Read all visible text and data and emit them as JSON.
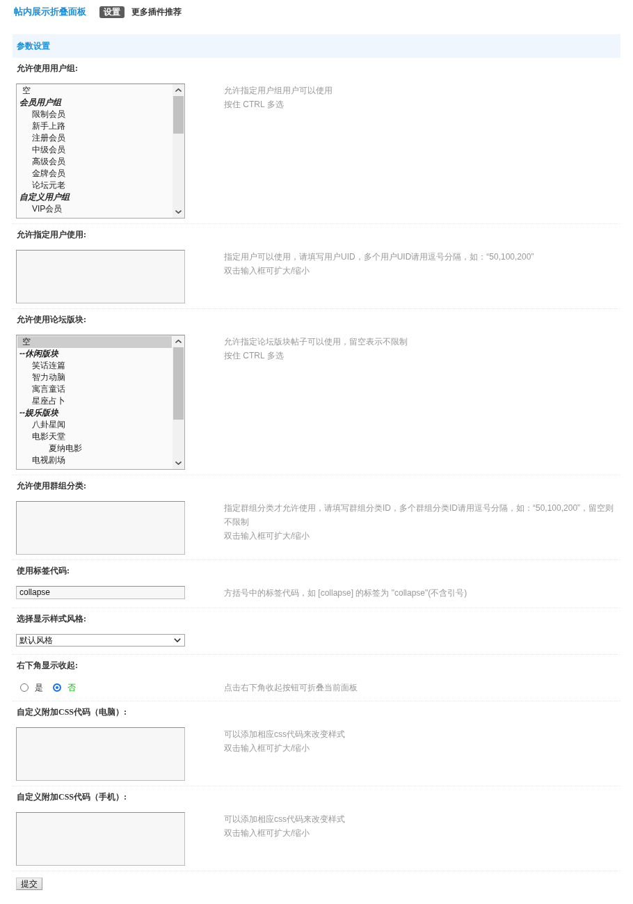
{
  "header": {
    "title": "帖内展示折叠面板",
    "tabs": [
      {
        "label": "设置",
        "selected": true
      },
      {
        "label": "更多插件推荐",
        "selected": false
      }
    ]
  },
  "section": {
    "title": "参数设置"
  },
  "settings": [
    {
      "kind": "listbox",
      "label": "允许使用用户组:",
      "items": [
        {
          "kind": "option",
          "label": "空",
          "selected": false
        },
        {
          "kind": "group",
          "label": "会员用户组",
          "children": [
            {
              "kind": "option",
              "label": "限制会员",
              "selected": false
            },
            {
              "kind": "option",
              "label": "新手上路",
              "selected": false
            },
            {
              "kind": "option",
              "label": "注册会员",
              "selected": false
            },
            {
              "kind": "option",
              "label": "中级会员",
              "selected": false
            },
            {
              "kind": "option",
              "label": "高级会员",
              "selected": false
            },
            {
              "kind": "option",
              "label": "金牌会员",
              "selected": false
            },
            {
              "kind": "option",
              "label": "论坛元老",
              "selected": false
            }
          ]
        },
        {
          "kind": "group",
          "label": "自定义用户组",
          "children": [
            {
              "kind": "option",
              "label": "VIP会员",
              "selected": false
            }
          ]
        }
      ],
      "tips": [
        "允许指定用户组用户可以使用",
        "按住 CTRL 多选"
      ]
    },
    {
      "kind": "textarea",
      "label": "允许指定用户使用:",
      "tips": [
        "指定用户可以使用，请填写用户UID，多个用户UID请用逗号分隔，如：“50,100,200”",
        "双击输入框可扩大/缩小"
      ]
    },
    {
      "kind": "listbox",
      "label": "允许使用论坛版块:",
      "items": [
        {
          "kind": "option",
          "label": "空",
          "selected": true
        },
        {
          "kind": "group",
          "label": "--休闲版块",
          "children": [
            {
              "kind": "option",
              "label": "笑话连篇",
              "selected": false
            },
            {
              "kind": "option",
              "label": "智力动脑",
              "selected": false
            },
            {
              "kind": "option",
              "label": "寓言童话",
              "selected": false
            },
            {
              "kind": "option",
              "label": "星座占卜",
              "selected": false
            }
          ]
        },
        {
          "kind": "group",
          "label": "--娱乐版块",
          "children": [
            {
              "kind": "option",
              "label": "八卦星闻",
              "selected": false
            },
            {
              "kind": "option",
              "label": "电影天堂",
              "selected": false,
              "children": [
                {
                  "kind": "option",
                  "label": "夏纳电影",
                  "selected": false
                }
              ]
            },
            {
              "kind": "option",
              "label": "电视剧场",
              "selected": false
            }
          ]
        }
      ],
      "tips": [
        "允许指定论坛版块帖子可以使用，留空表示不限制",
        "按住 CTRL 多选"
      ]
    },
    {
      "kind": "textarea",
      "label": "允许使用群组分类:",
      "tips": [
        "指定群组分类才允许使用，请填写群组分类ID，多个群组分类ID请用逗号分隔，如：“50,100,200”，留空则不限制",
        "双击输入框可扩大/缩小"
      ]
    },
    {
      "kind": "text",
      "label": "使用标签代码:",
      "value": "collapse",
      "tips": [
        "方括号中的标签代码，如 [collapse] 的标签为 \"collapse\"(不含引号)"
      ]
    },
    {
      "kind": "select",
      "label": "选择显示样式风格:",
      "value": "默认风格"
    },
    {
      "kind": "radio",
      "label": "右下角显示收起:",
      "options": [
        {
          "label": "是",
          "selected": false
        },
        {
          "label": "否",
          "selected": true
        }
      ],
      "tips": [
        "点击右下角收起按钮可折叠当前面板"
      ]
    },
    {
      "kind": "textarea",
      "label": "自定义附加CSS代码（电脑）:",
      "tips": [
        "可以添加相应css代码来改变样式",
        "双击输入框可扩大/缩小"
      ]
    },
    {
      "kind": "textarea",
      "label": "自定义附加CSS代码（手机）:",
      "tips": [
        "可以添加相应css代码来改变样式",
        "双击输入框可扩大/缩小"
      ]
    }
  ],
  "submit": {
    "label": "提交"
  }
}
